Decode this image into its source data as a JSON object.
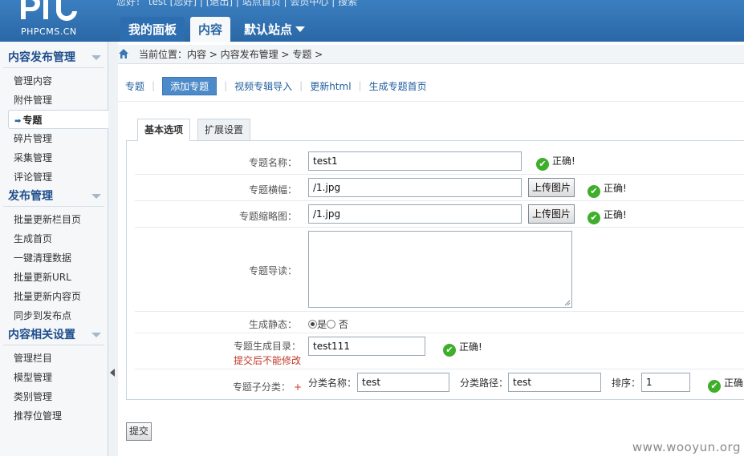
{
  "header": {
    "logo_text": "PHPCMS.CN",
    "top_links": "您好！ test [您好] | [退出] | 站点首页 | 会员中心 | 搜索",
    "tabs": [
      {
        "label": "我的面板"
      },
      {
        "label": "内容"
      },
      {
        "label": "默认站点"
      }
    ]
  },
  "sidebar": {
    "groups": [
      {
        "title": "内容发布管理",
        "items": [
          "管理内容",
          "附件管理",
          "专题",
          "碎片管理",
          "采集管理",
          "评论管理"
        ]
      },
      {
        "title": "发布管理",
        "items": [
          "批量更新栏目页",
          "生成首页",
          "一键清理数据",
          "批量更新URL",
          "批量更新内容页",
          "同步到发布点"
        ]
      },
      {
        "title": "内容相关设置",
        "items": [
          "管理栏目",
          "模型管理",
          "类别管理",
          "推荐位管理"
        ]
      }
    ]
  },
  "breadcrumb": "当前位置：内容 > 内容发布管理 > 专题 >",
  "subnav": {
    "items": [
      "专题",
      "添加专题",
      "视频专辑导入",
      "更新html",
      "生成专题首页"
    ]
  },
  "form_tabs": [
    "基本选项",
    "扩展设置"
  ],
  "form": {
    "name_label": "专题名称：",
    "name_value": "test1",
    "banner_label": "专题横幅：",
    "banner_value": "/1.jpg",
    "thumb_label": "专题缩略图：",
    "thumb_value": "/1.jpg",
    "upload_label": "上传图片",
    "intro_label": "专题导读：",
    "static_label": "生成静态：",
    "static_yes": "是",
    "static_no": "否",
    "dir_label": "专题生成目录：",
    "dir_warning": "提交后不能修改",
    "dir_value": "test111",
    "sub_label": "专题子分类：",
    "sub_plus": "+",
    "sub_name_label": "分类名称：",
    "sub_name_value": "test",
    "sub_path_label": "分类路径：",
    "sub_path_value": "test",
    "sub_order_label": "排序：",
    "sub_order_value": "1",
    "ok_text": "正确!",
    "ok_text_cut": "正确"
  },
  "submit_label": "提交",
  "watermark": "www.wooyun.org",
  "colors": {
    "header_blue": "#2a67a6",
    "ok_green": "#3fae2a",
    "warning_red": "#c0392b"
  }
}
